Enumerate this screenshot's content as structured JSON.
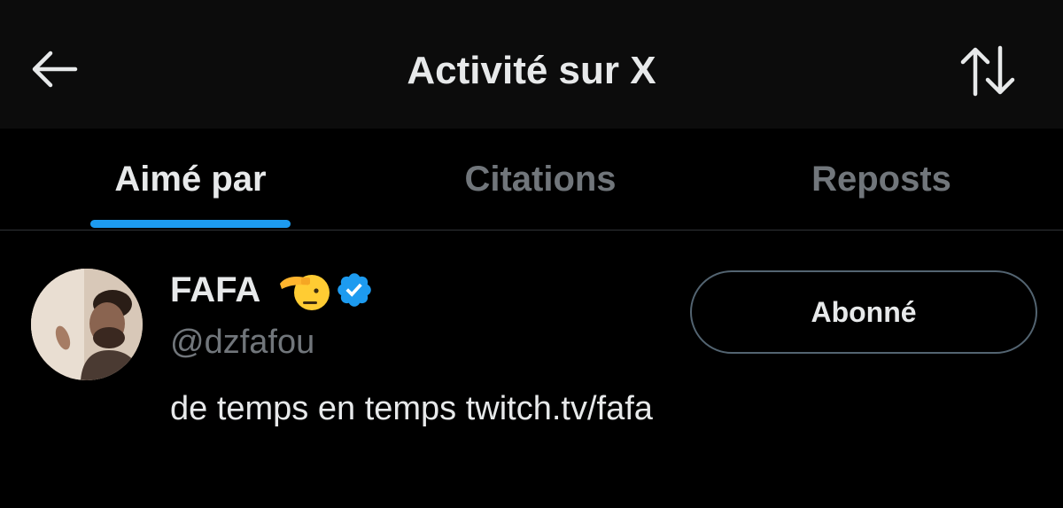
{
  "header": {
    "title": "Activité sur X",
    "back_icon": "arrow-left-icon",
    "sort_icon": "sort-arrows-icon"
  },
  "tabs": [
    {
      "label": "Aimé par",
      "active": true
    },
    {
      "label": "Citations",
      "active": false
    },
    {
      "label": "Reposts",
      "active": false
    }
  ],
  "user": {
    "display_name": "FAFA",
    "emoji": "🫡",
    "verified": true,
    "handle": "@dzfafou",
    "bio": "de temps en temps twitch.tv/fafa",
    "follow_label": "Abonné"
  },
  "colors": {
    "background": "#000000",
    "header_background": "#0c0c0c",
    "accent": "#1d9bf0",
    "text_primary": "#e7e9ea",
    "text_secondary": "#71767b",
    "border": "#2f3336"
  }
}
